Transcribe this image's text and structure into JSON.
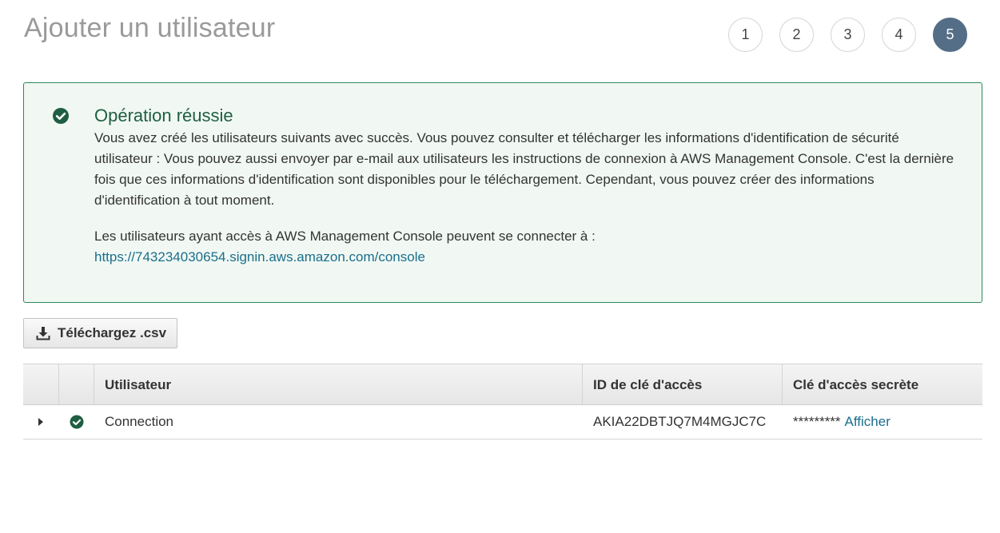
{
  "page": {
    "title": "Ajouter un utilisateur"
  },
  "steps": [
    {
      "label": "1",
      "active": false
    },
    {
      "label": "2",
      "active": false
    },
    {
      "label": "3",
      "active": false
    },
    {
      "label": "4",
      "active": false
    },
    {
      "label": "5",
      "active": true
    }
  ],
  "alert": {
    "icon": "check-circle-icon",
    "title": "Opération réussie",
    "message": "Vous avez créé les utilisateurs suivants avec succès. Vous pouvez consulter et télécharger les informations d'identification de sécurité utilisateur : Vous pouvez aussi envoyer par e-mail aux utilisateurs les instructions de connexion à AWS Management Console. C'est la dernière fois que ces informations d'identification sont disponibles pour le téléchargement. Cependant, vous pouvez créer des informations d'identification à tout moment.",
    "console_text": "Les utilisateurs ayant accès à AWS Management Console peuvent se connecter à :",
    "console_url": "https://743234030654.signin.aws.amazon.com/console"
  },
  "download_button": {
    "icon": "download-icon",
    "label": "Téléchargez .csv"
  },
  "table": {
    "columns": [
      "",
      "",
      "Utilisateur",
      "ID de clé d'accès",
      "Clé d'accès secrète"
    ],
    "rows": [
      {
        "user": "Connection",
        "access_key_id": "AKIA22DBTJQ7M4MGJC7C",
        "secret_mask": "*********",
        "secret_action": "Afficher"
      }
    ]
  },
  "colors": {
    "active_step": "#546e87",
    "success_border": "#2b8a5e",
    "success_bg": "#f1f8f3",
    "link": "#1b6e8c"
  }
}
